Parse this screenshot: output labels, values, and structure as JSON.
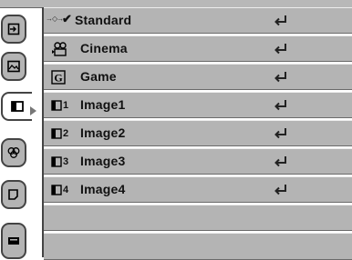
{
  "menu": {
    "items": [
      {
        "label": "Standard",
        "icon": "standard-check-icon",
        "selected": true
      },
      {
        "label": "Cinema",
        "icon": "cinema-camera-icon"
      },
      {
        "label": "Game",
        "icon": "game-g-icon"
      },
      {
        "label": "Image1",
        "icon": "image-memory-icon",
        "num": "1"
      },
      {
        "label": "Image2",
        "icon": "image-memory-icon",
        "num": "2"
      },
      {
        "label": "Image3",
        "icon": "image-memory-icon",
        "num": "3"
      },
      {
        "label": "Image4",
        "icon": "image-memory-icon",
        "num": "4"
      },
      {
        "label": ""
      },
      {
        "label": ""
      }
    ],
    "selected_marker": "✔"
  },
  "sidebar": {
    "tabs": [
      "input-icon",
      "picture-adjust-icon",
      "image-select-icon",
      "color-icon",
      "screen-icon",
      "projector-icon"
    ],
    "active_tab": "image-select-icon"
  },
  "colors": {
    "row_bg": "#b4b4b4",
    "tab_bg": "#b4b4b4",
    "text": "#111111"
  }
}
